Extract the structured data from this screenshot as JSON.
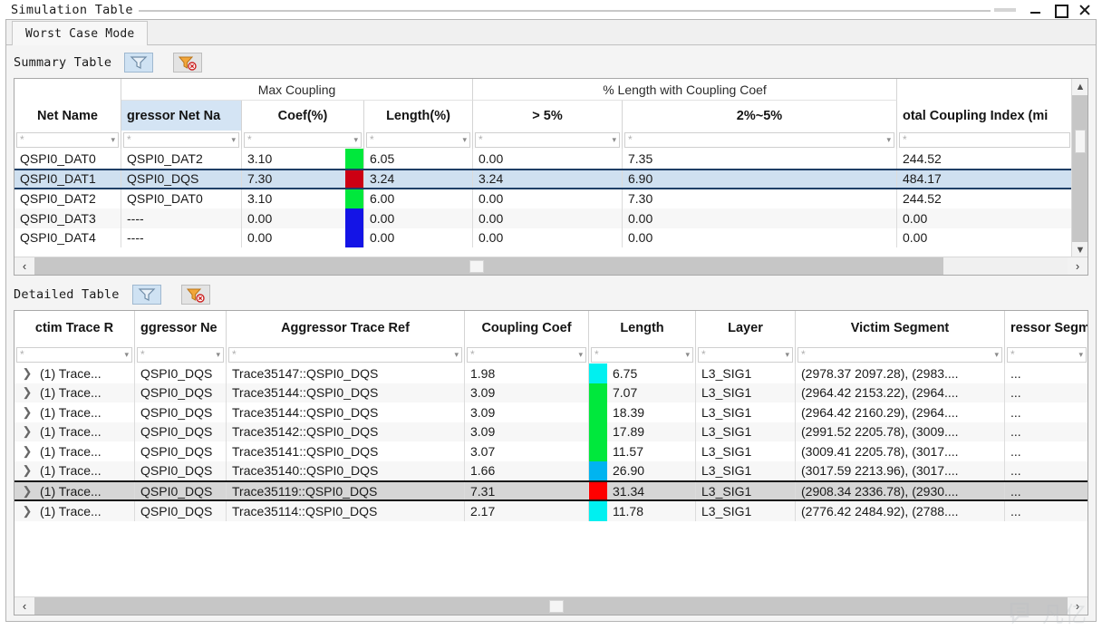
{
  "window": {
    "title": "Simulation Table",
    "controls": {
      "minimize": "minimize-icon",
      "maximize": "maximize-icon",
      "close": "close-icon"
    }
  },
  "tab": {
    "label": "Worst Case Mode"
  },
  "summary": {
    "label": "Summary Table",
    "filter_button": "filter-icon",
    "clear_filter_button": "clear-filter-icon",
    "group_headers": [
      {
        "label": "",
        "span": 1
      },
      {
        "label": "Max Coupling",
        "span": 3
      },
      {
        "label": "% Length with Coupling Coef",
        "span": 2
      },
      {
        "label": "",
        "span": 1
      }
    ],
    "columns": [
      "Net Name",
      "gressor Net Na",
      "Coef(%)",
      "Length(%)",
      "> 5%",
      "2%~5%",
      "otal Coupling Index (mi"
    ],
    "filter_placeholder": "*",
    "rows": [
      {
        "net": "QSPI0_DAT0",
        "aggressor": "QSPI0_DAT2",
        "coef": "3.10",
        "color": "#00e83c",
        "length": "6.05",
        "gt5": "0.00",
        "r2to5": "7.35",
        "index": "244.52",
        "selected": false
      },
      {
        "net": "QSPI0_DAT1",
        "aggressor": "QSPI0_DQS",
        "coef": "7.30",
        "color": "#cc0013",
        "length": "3.24",
        "gt5": "3.24",
        "r2to5": "6.90",
        "index": "484.17",
        "selected": true
      },
      {
        "net": "QSPI0_DAT2",
        "aggressor": "QSPI0_DAT0",
        "coef": "3.10",
        "color": "#00e83c",
        "length": "6.00",
        "gt5": "0.00",
        "r2to5": "7.30",
        "index": "244.52",
        "selected": false
      },
      {
        "net": "QSPI0_DAT3",
        "aggressor": "----",
        "coef": "0.00",
        "color": "#1414e6",
        "length": "0.00",
        "gt5": "0.00",
        "r2to5": "0.00",
        "index": "0.00",
        "selected": false
      },
      {
        "net": "QSPI0_DAT4",
        "aggressor": "----",
        "coef": "0.00",
        "color": "#1414e6",
        "length": "0.00",
        "gt5": "0.00",
        "r2to5": "0.00",
        "index": "0.00",
        "selected": false
      }
    ]
  },
  "detailed": {
    "label": "Detailed Table",
    "filter_button": "filter-icon",
    "clear_filter_button": "clear-filter-icon",
    "columns": [
      "ctim Trace R",
      "ggressor Ne",
      "Aggressor Trace Ref",
      "Coupling Coef",
      "Length",
      "Layer",
      "Victim Segment",
      "ressor Segm"
    ],
    "filter_placeholder": "*",
    "rows": [
      {
        "victim": "(1) Trace...",
        "aggr_net": "QSPI0_DQS",
        "aggr_trace": "Trace35147::QSPI0_DQS",
        "coef": "1.98",
        "color": "#00f0f0",
        "length": "6.75",
        "layer": "L3_SIG1",
        "victim_seg": "(2978.37 2097.28), (2983....",
        "aggr_seg": "...",
        "selected": false
      },
      {
        "victim": "(1) Trace...",
        "aggr_net": "QSPI0_DQS",
        "aggr_trace": "Trace35144::QSPI0_DQS",
        "coef": "3.09",
        "color": "#00e83c",
        "length": "7.07",
        "layer": "L3_SIG1",
        "victim_seg": "(2964.42 2153.22), (2964....",
        "aggr_seg": "...",
        "selected": false
      },
      {
        "victim": "(1) Trace...",
        "aggr_net": "QSPI0_DQS",
        "aggr_trace": "Trace35144::QSPI0_DQS",
        "coef": "3.09",
        "color": "#00e83c",
        "length": "18.39",
        "layer": "L3_SIG1",
        "victim_seg": "(2964.42 2160.29), (2964....",
        "aggr_seg": "...",
        "selected": false
      },
      {
        "victim": "(1) Trace...",
        "aggr_net": "QSPI0_DQS",
        "aggr_trace": "Trace35142::QSPI0_DQS",
        "coef": "3.09",
        "color": "#00e83c",
        "length": "17.89",
        "layer": "L3_SIG1",
        "victim_seg": "(2991.52 2205.78), (3009....",
        "aggr_seg": "...",
        "selected": false
      },
      {
        "victim": "(1) Trace...",
        "aggr_net": "QSPI0_DQS",
        "aggr_trace": "Trace35141::QSPI0_DQS",
        "coef": "3.07",
        "color": "#00e83c",
        "length": "11.57",
        "layer": "L3_SIG1",
        "victim_seg": "(3009.41 2205.78), (3017....",
        "aggr_seg": "...",
        "selected": false
      },
      {
        "victim": "(1) Trace...",
        "aggr_net": "QSPI0_DQS",
        "aggr_trace": "Trace35140::QSPI0_DQS",
        "coef": "1.66",
        "color": "#00b4f0",
        "length": "26.90",
        "layer": "L3_SIG1",
        "victim_seg": "(3017.59 2213.96), (3017....",
        "aggr_seg": "...",
        "selected": false
      },
      {
        "victim": "(1) Trace...",
        "aggr_net": "QSPI0_DQS",
        "aggr_trace": "Trace35119::QSPI0_DQS",
        "coef": "7.31",
        "color": "#ff0000",
        "length": "31.34",
        "layer": "L3_SIG1",
        "victim_seg": "(2908.34 2336.78), (2930....",
        "aggr_seg": "...",
        "selected": true
      },
      {
        "victim": "(1) Trace...",
        "aggr_net": "QSPI0_DQS",
        "aggr_trace": "Trace35114::QSPI0_DQS",
        "coef": "2.17",
        "color": "#00f0f0",
        "length": "11.78",
        "layer": "L3_SIG1",
        "victim_seg": "(2776.42 2484.92), (2788....",
        "aggr_seg": "...",
        "selected": false
      }
    ]
  },
  "watermark": {
    "text": "凡亿"
  }
}
